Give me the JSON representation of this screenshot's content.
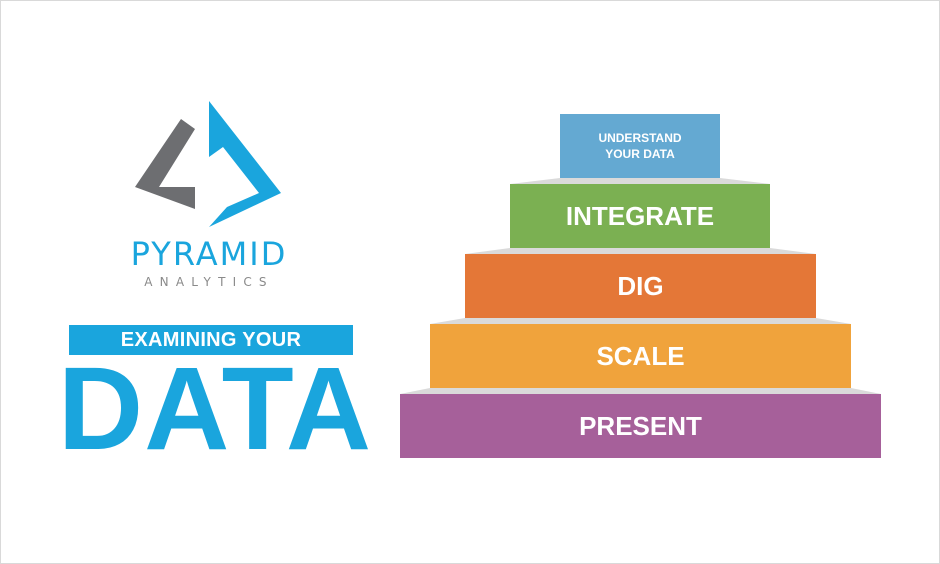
{
  "logo": {
    "name": "PYRAMID",
    "subtitle": "ANALYTICS",
    "mark_icon": "pyramid-analytics-logo-icon",
    "colors": {
      "gray": "#6d6e71",
      "blue": "#1aa5dd",
      "subtitle": "#8a8a8a"
    }
  },
  "headline": {
    "banner_text": "EXAMINING YOUR",
    "main_word": "DATA",
    "color": "#1aa5dd"
  },
  "pyramid": {
    "steps": [
      {
        "label": "UNDERSTAND YOUR DATA",
        "color": "#64a9d2"
      },
      {
        "label": "INTEGRATE",
        "color": "#7bb052"
      },
      {
        "label": "DIG",
        "color": "#e47737"
      },
      {
        "label": "SCALE",
        "color": "#f0a33c"
      },
      {
        "label": "PRESENT",
        "color": "#a6609a"
      }
    ]
  }
}
